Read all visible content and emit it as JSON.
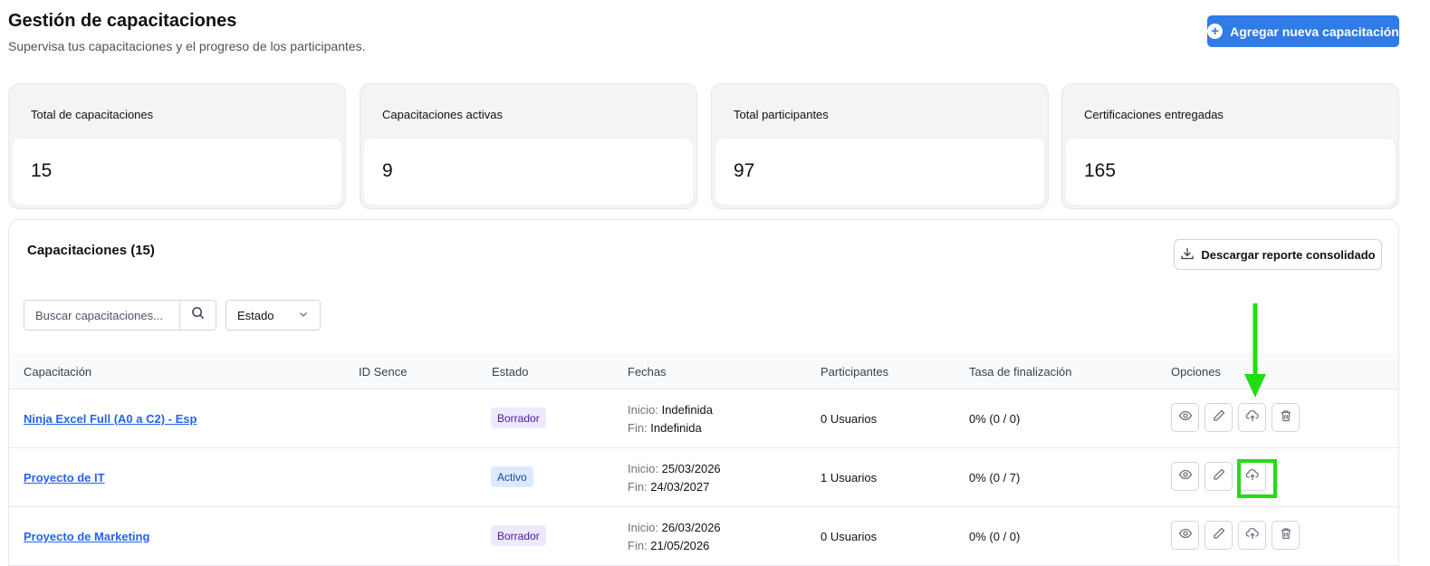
{
  "header": {
    "title": "Gestión de capacitaciones",
    "subtitle": "Supervisa tus capacitaciones y el progreso de los participantes.",
    "add_button": "Agregar nueva capacitación"
  },
  "stats": [
    {
      "label": "Total de capacitaciones",
      "value": "15"
    },
    {
      "label": "Capacitaciones activas",
      "value": "9"
    },
    {
      "label": "Total participantes",
      "value": "97"
    },
    {
      "label": "Certificaciones entregadas",
      "value": "165"
    }
  ],
  "panel": {
    "title": "Capacitaciones (15)",
    "report_button": "Descargar reporte consolidado",
    "search_placeholder": "Buscar capacitaciones...",
    "status_select": "Estado"
  },
  "table": {
    "headers": [
      "Capacitación",
      "ID Sence",
      "Estado",
      "Fechas",
      "Participantes",
      "Tasa de finalización",
      "Opciones"
    ],
    "start_label": "Inicio:",
    "end_label": "Fin:",
    "rows": [
      {
        "name": "Ninja Excel Full (A0 a C2) - Esp",
        "sence": "",
        "status": "Borrador",
        "start": "Indefinida",
        "end": "Indefinida",
        "participants": "0 Usuarios",
        "rate": "0% (0 / 0)"
      },
      {
        "name": "Proyecto de IT",
        "sence": "",
        "status": "Activo",
        "start": "25/03/2026",
        "end": "24/03/2027",
        "participants": "1 Usuarios",
        "rate": "0% (0 / 7)"
      },
      {
        "name": "Proyecto de Marketing",
        "sence": "",
        "status": "Borrador",
        "start": "26/03/2026",
        "end": "21/05/2026",
        "participants": "0 Usuarios",
        "rate": "0% (0 / 0)"
      }
    ]
  },
  "colors": {
    "accent": "#2f7be8",
    "link": "#2563eb",
    "annotation": "#22dd11"
  },
  "icons": [
    "plus-circle-icon",
    "download-icon",
    "search-icon",
    "chevron-down-icon",
    "eye-icon",
    "pencil-icon",
    "cloud-upload-icon",
    "trash-icon"
  ]
}
